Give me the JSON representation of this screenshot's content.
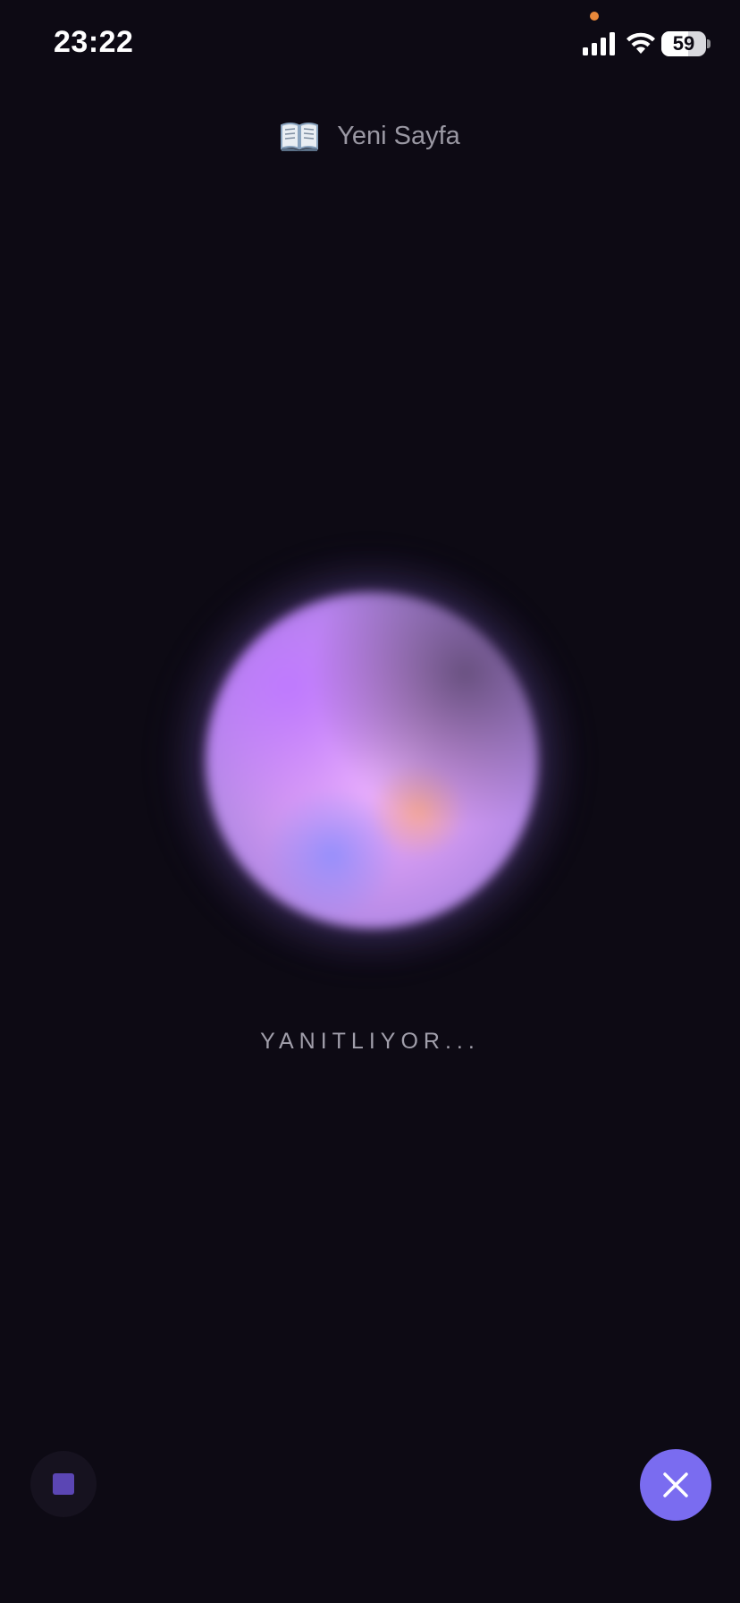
{
  "status_bar": {
    "time": "23:22",
    "battery_level": "59",
    "battery_percent": 59,
    "icons": [
      "signal-icon",
      "wifi-icon",
      "battery-icon",
      "privacy-indicator-dot"
    ]
  },
  "header": {
    "icon": "open-book-icon",
    "title": "Yeni Sayfa"
  },
  "orb": {
    "state": "speaking"
  },
  "status_text": "YANITLIYOR...",
  "controls": {
    "stop_icon": "stop-icon",
    "close_icon": "close-icon"
  },
  "colors": {
    "background": "#0d0a14",
    "accent": "#7a6cf0",
    "stop_square": "#5b46b4",
    "privacy_dot": "#e8883a"
  }
}
